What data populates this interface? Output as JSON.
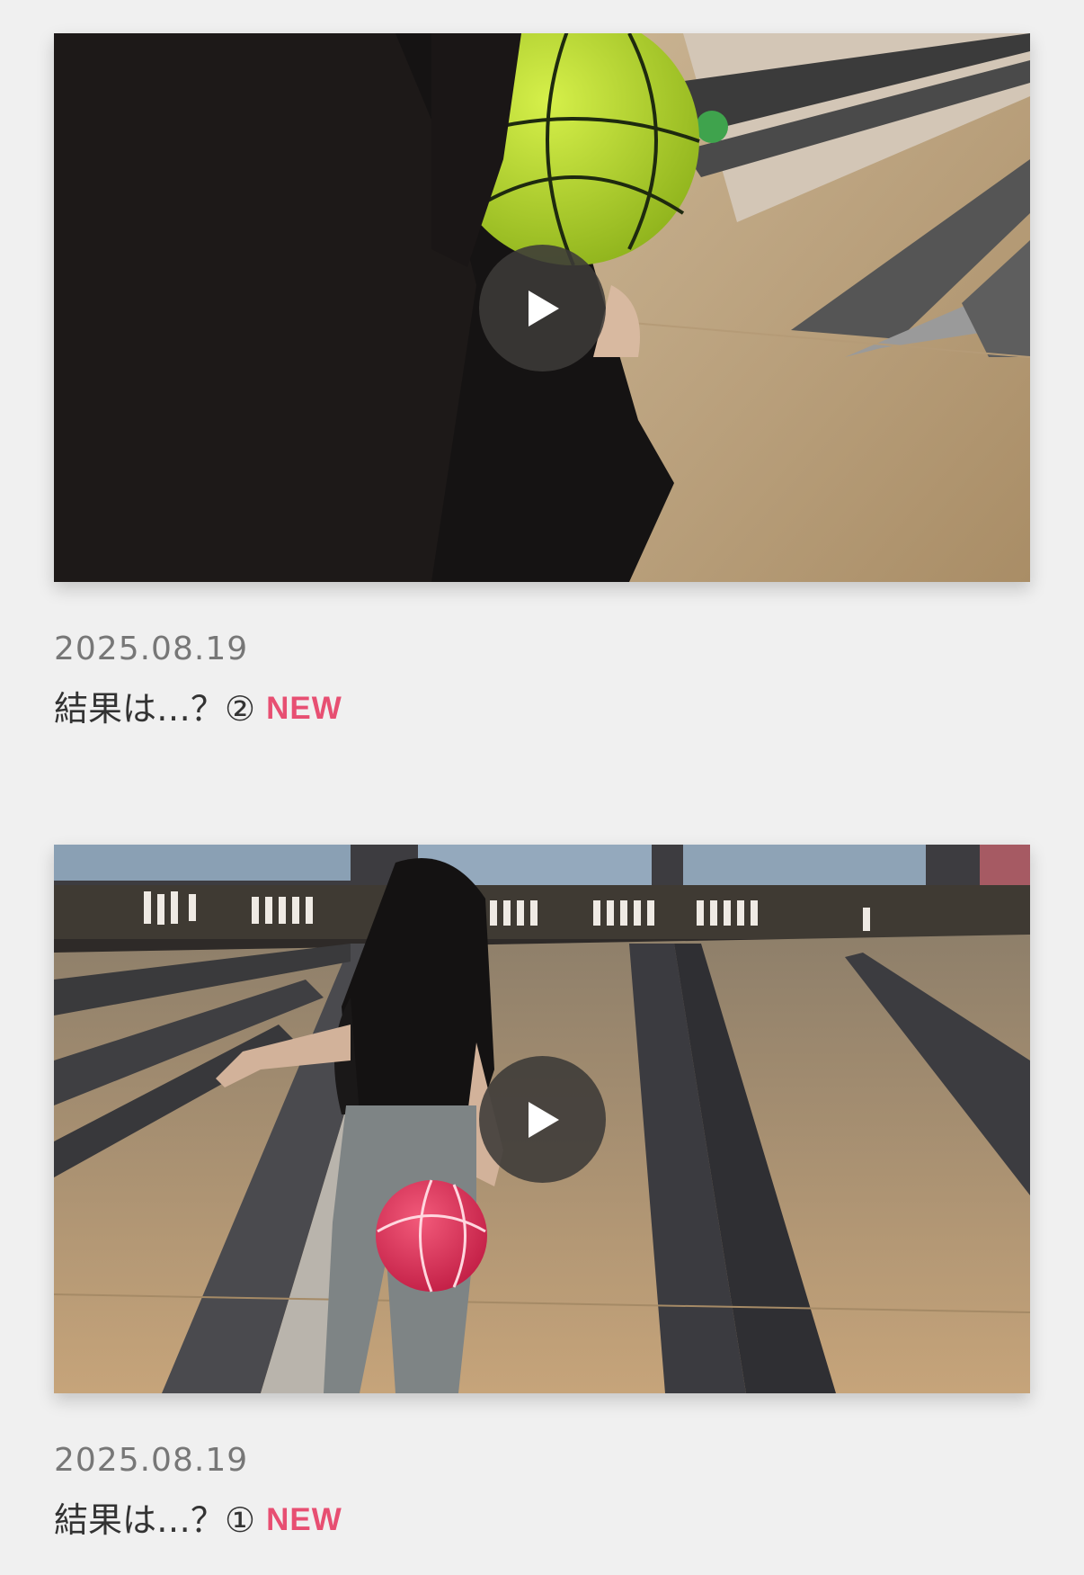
{
  "posts": [
    {
      "date": "2025.08.19",
      "title": "結果は…？②",
      "badge": "NEW",
      "thumbnail": "bowling-video-thumbnail-closeup",
      "play_icon": "play-icon"
    },
    {
      "date": "2025.08.19",
      "title": "結果は…？①",
      "badge": "NEW",
      "thumbnail": "bowling-video-thumbnail-lanes",
      "play_icon": "play-icon"
    }
  ],
  "colors": {
    "background": "#f0f0f0",
    "badge": "#e74f72",
    "date_text": "#777777",
    "title_text": "#333333",
    "play_button": "#3c3a38"
  }
}
